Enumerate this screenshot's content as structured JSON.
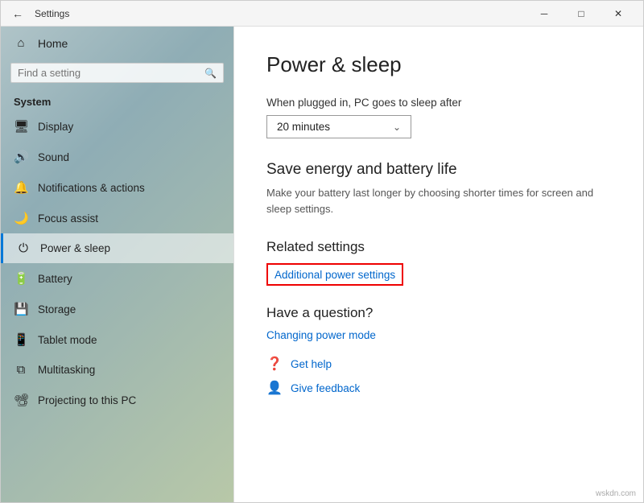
{
  "window": {
    "title": "Settings",
    "back_label": "←",
    "minimize_label": "─",
    "maximize_label": "□",
    "close_label": "✕"
  },
  "sidebar": {
    "home_label": "Home",
    "search_placeholder": "Find a setting",
    "section_label": "System",
    "items": [
      {
        "id": "display",
        "label": "Display",
        "icon": "🖥"
      },
      {
        "id": "sound",
        "label": "Sound",
        "icon": "🔊"
      },
      {
        "id": "notifications",
        "label": "Notifications & actions",
        "icon": "🔔"
      },
      {
        "id": "focus",
        "label": "Focus assist",
        "icon": "🌙"
      },
      {
        "id": "power",
        "label": "Power & sleep",
        "icon": "⏻"
      },
      {
        "id": "battery",
        "label": "Battery",
        "icon": "🔋"
      },
      {
        "id": "storage",
        "label": "Storage",
        "icon": "💾"
      },
      {
        "id": "tablet",
        "label": "Tablet mode",
        "icon": "📱"
      },
      {
        "id": "multitasking",
        "label": "Multitasking",
        "icon": "⧉"
      },
      {
        "id": "projecting",
        "label": "Projecting to this PC",
        "icon": "📽"
      }
    ]
  },
  "main": {
    "title": "Power & sleep",
    "sleep_label": "When plugged in, PC goes to sleep after",
    "sleep_value": "20 minutes",
    "energy_title": "Save energy and battery life",
    "energy_desc": "Make your battery last longer by choosing shorter times for screen and sleep settings.",
    "related_title": "Related settings",
    "additional_power_label": "Additional power settings",
    "question_title": "Have a question?",
    "question_link": "Changing power mode",
    "help_items": [
      {
        "icon": "❓",
        "label": "Get help"
      },
      {
        "icon": "👤",
        "label": "Give feedback"
      }
    ]
  },
  "watermark": "wskdn.com"
}
